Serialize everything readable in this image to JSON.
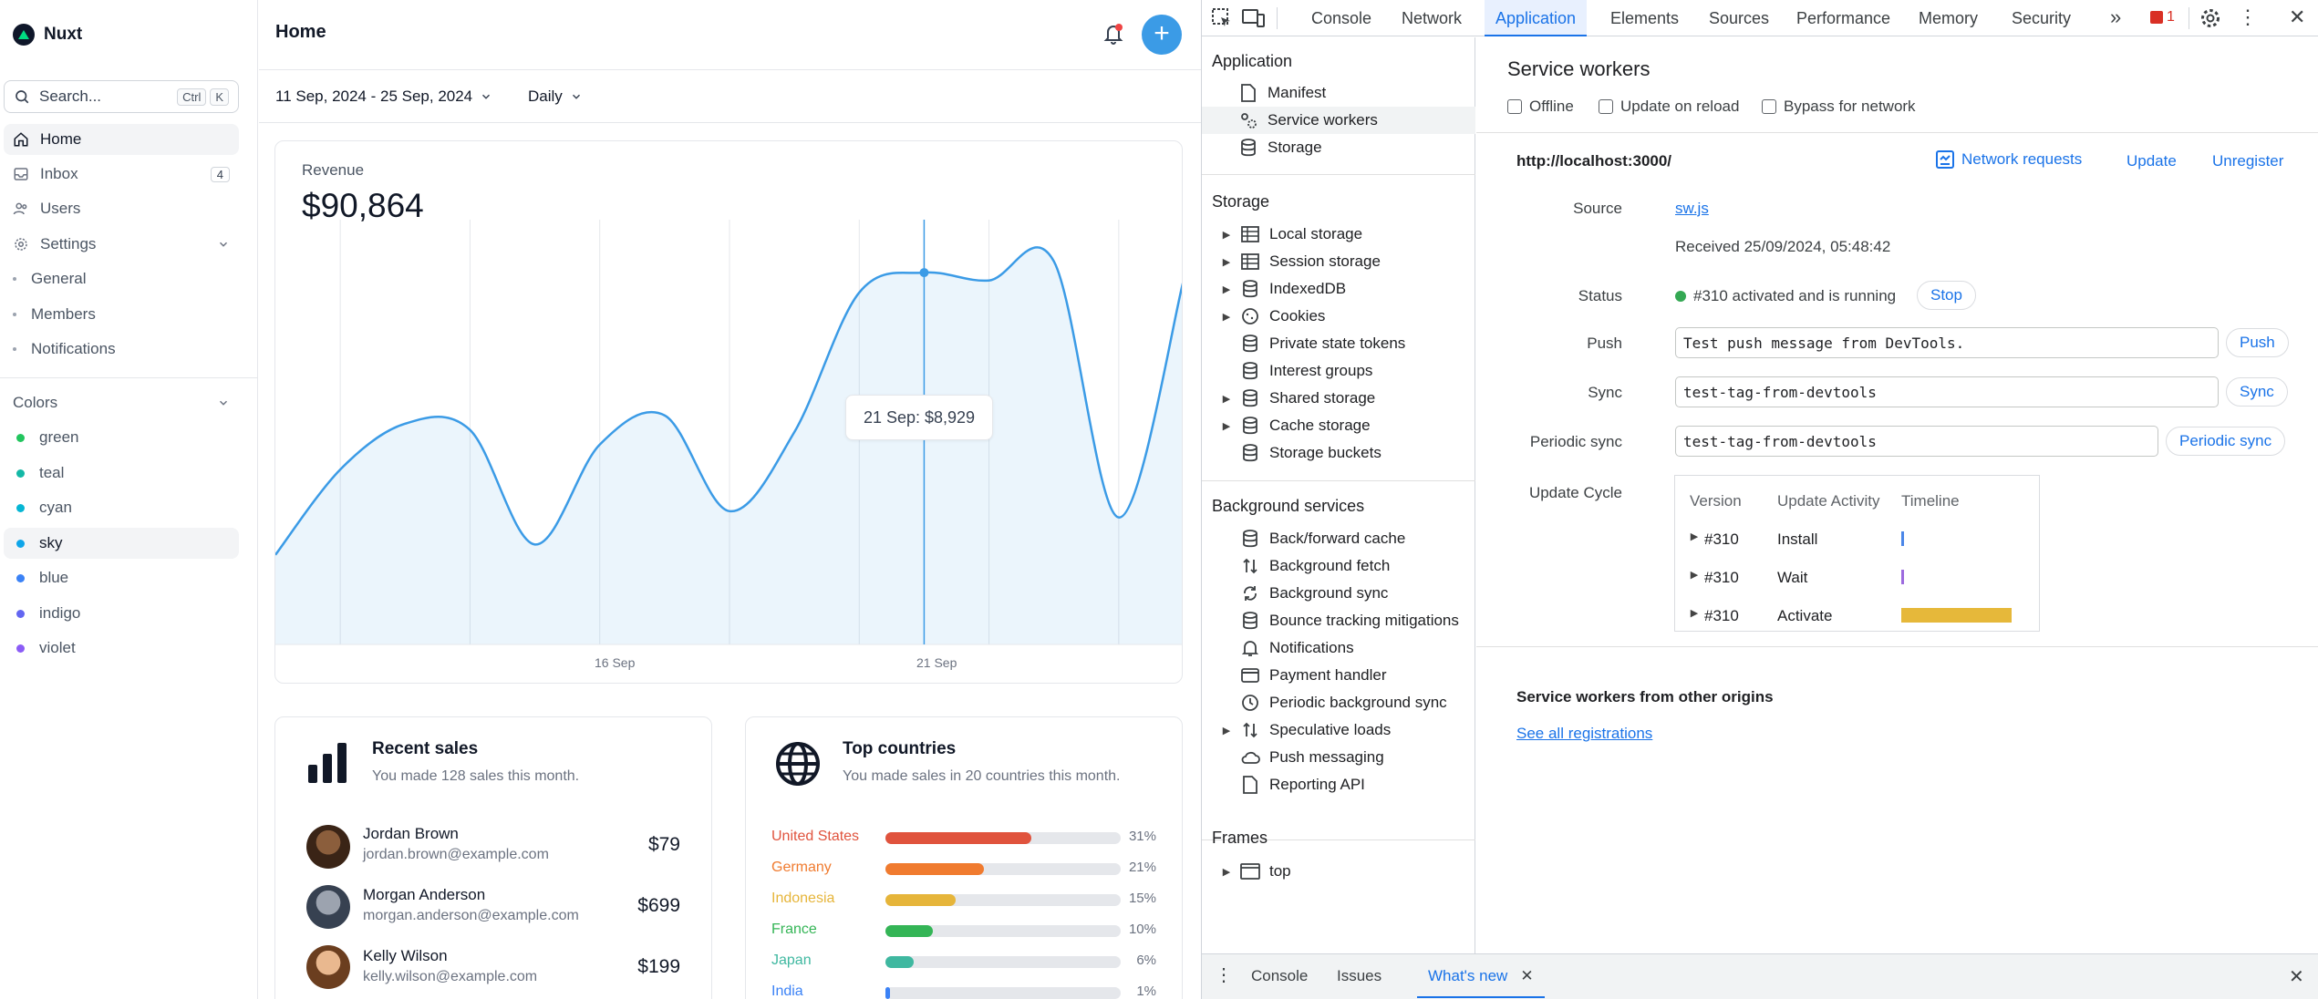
{
  "app": {
    "brand": "Nuxt",
    "search": {
      "label": "Search...",
      "kbd1": "Ctrl",
      "kbd2": "K"
    },
    "nav": [
      {
        "label": "Home",
        "icon": "home-icon",
        "active": true
      },
      {
        "label": "Inbox",
        "icon": "inbox-icon",
        "badge": "4"
      },
      {
        "label": "Users",
        "icon": "users-icon"
      },
      {
        "label": "Settings",
        "icon": "gear-icon"
      }
    ],
    "settings_sub": [
      "General",
      "Members",
      "Notifications"
    ],
    "colors_heading": "Colors",
    "colors": [
      {
        "label": "green",
        "color": "#22c55e"
      },
      {
        "label": "teal",
        "color": "#14b8a6"
      },
      {
        "label": "cyan",
        "color": "#06b6d4"
      },
      {
        "label": "sky",
        "color": "#0ea5e9",
        "active": true
      },
      {
        "label": "blue",
        "color": "#3b82f6"
      },
      {
        "label": "indigo",
        "color": "#6366f1"
      },
      {
        "label": "violet",
        "color": "#8b5cf6"
      }
    ]
  },
  "main": {
    "title": "Home",
    "date_range": "11 Sep, 2024 - 25 Sep, 2024",
    "period": "Daily",
    "revenue_label": "Revenue",
    "revenue_value": "$90,864",
    "tooltip": "21 Sep: $8,929",
    "sales": {
      "title": "Recent sales",
      "subtitle": "You made 128 sales this month.",
      "rows": [
        {
          "name": "Jordan Brown",
          "email": "jordan.brown@example.com",
          "amount": "$79"
        },
        {
          "name": "Morgan Anderson",
          "email": "morgan.anderson@example.com",
          "amount": "$699"
        },
        {
          "name": "Kelly Wilson",
          "email": "kelly.wilson@example.com",
          "amount": "$199"
        }
      ]
    },
    "countries": {
      "title": "Top countries",
      "subtitle": "You made sales in 20 countries this month.",
      "rows": [
        {
          "name": "United States",
          "pct": "31%",
          "value": 31,
          "color": "#e0533d"
        },
        {
          "name": "Germany",
          "pct": "21%",
          "value": 21,
          "color": "#f07b2f"
        },
        {
          "name": "Indonesia",
          "pct": "15%",
          "value": 15,
          "color": "#e6b53a"
        },
        {
          "name": "France",
          "pct": "10%",
          "value": 10,
          "color": "#34b556"
        },
        {
          "name": "Japan",
          "pct": "6%",
          "value": 6,
          "color": "#3fb8a0"
        },
        {
          "name": "India",
          "pct": "1%",
          "value": 1,
          "color": "#3b82f6"
        }
      ]
    }
  },
  "chart_data": {
    "type": "area",
    "title": "",
    "x": [
      "11 Sep",
      "12 Sep",
      "13 Sep",
      "14 Sep",
      "15 Sep",
      "16 Sep",
      "17 Sep",
      "18 Sep",
      "19 Sep",
      "20 Sep",
      "21 Sep",
      "22 Sep",
      "23 Sep",
      "24 Sep",
      "25 Sep"
    ],
    "series": [
      {
        "values": [
          2150,
          4200,
          5300,
          5150,
          2400,
          4800,
          5500,
          3200,
          5100,
          8450,
          8929,
          8740,
          9200,
          3050,
          8750
        ]
      }
    ],
    "tick_labels": [
      "16 Sep",
      "21 Sep"
    ],
    "ylim": [
      0,
      10200
    ],
    "highlight": "21 Sep",
    "grid": "vertical",
    "color": "#3b9be6"
  },
  "devtools": {
    "tabs": [
      "Console",
      "Network",
      "Application",
      "Elements",
      "Sources",
      "Performance",
      "Memory",
      "Security"
    ],
    "active_tab": "Application",
    "error_count": "1",
    "tree": {
      "application_heading": "Application",
      "application": [
        "Manifest",
        "Service workers",
        "Storage"
      ],
      "storage_heading": "Storage",
      "storage": [
        "Local storage",
        "Session storage",
        "IndexedDB",
        "Cookies",
        "Private state tokens",
        "Interest groups",
        "Shared storage",
        "Cache storage",
        "Storage buckets"
      ],
      "background_heading": "Background services",
      "background": [
        "Back/forward cache",
        "Background fetch",
        "Background sync",
        "Bounce tracking mitigations",
        "Notifications",
        "Payment handler",
        "Periodic background sync",
        "Speculative loads",
        "Push messaging",
        "Reporting API"
      ],
      "frames_heading": "Frames",
      "frames": [
        "top"
      ]
    },
    "sw": {
      "title": "Service workers",
      "offline": "Offline",
      "update_on_reload": "Update on reload",
      "bypass": "Bypass for network",
      "origin": "http://localhost:3000/",
      "network_requests": "Network requests",
      "update": "Update",
      "unregister": "Unregister",
      "source_label": "Source",
      "source_file": "sw.js",
      "received": "Received 25/09/2024, 05:48:42",
      "status_label": "Status",
      "status_text": "#310 activated and is running",
      "stop": "Stop",
      "push_label": "Push",
      "push_value": "Test push message from DevTools.",
      "push_btn": "Push",
      "sync_label": "Sync",
      "sync_value": "test-tag-from-devtools",
      "sync_btn": "Sync",
      "periodic_label": "Periodic sync",
      "periodic_value": "test-tag-from-devtools",
      "periodic_btn": "Periodic sync",
      "cycle_label": "Update Cycle",
      "cycle_headers": [
        "Version",
        "Update Activity",
        "Timeline"
      ],
      "cycle_rows": [
        {
          "version": "#310",
          "activity": "Install",
          "color": "#4a86e8"
        },
        {
          "version": "#310",
          "activity": "Wait",
          "color": "#9c6ade"
        },
        {
          "version": "#310",
          "activity": "Activate",
          "color": "#e6b83a"
        }
      ],
      "other_title": "Service workers from other origins",
      "see_all": "See all registrations"
    },
    "drawer_tabs": [
      "Console",
      "Issues",
      "What's new"
    ]
  }
}
